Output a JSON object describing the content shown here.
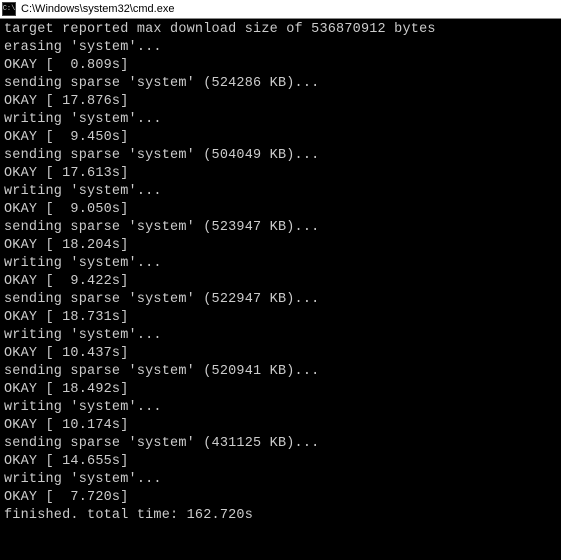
{
  "window": {
    "title": "C:\\Windows\\system32\\cmd.exe",
    "icon_label": "C:\\"
  },
  "lines": [
    "target reported max download size of 536870912 bytes",
    "erasing 'system'...",
    "OKAY [  0.809s]",
    "sending sparse 'system' (524286 KB)...",
    "OKAY [ 17.876s]",
    "writing 'system'...",
    "OKAY [  9.450s]",
    "sending sparse 'system' (504049 KB)...",
    "OKAY [ 17.613s]",
    "writing 'system'...",
    "OKAY [  9.050s]",
    "sending sparse 'system' (523947 KB)...",
    "OKAY [ 18.204s]",
    "writing 'system'...",
    "OKAY [  9.422s]",
    "sending sparse 'system' (522947 KB)...",
    "OKAY [ 18.731s]",
    "writing 'system'...",
    "OKAY [ 10.437s]",
    "sending sparse 'system' (520941 KB)...",
    "OKAY [ 18.492s]",
    "writing 'system'...",
    "OKAY [ 10.174s]",
    "sending sparse 'system' (431125 KB)...",
    "OKAY [ 14.655s]",
    "writing 'system'...",
    "OKAY [  7.720s]",
    "finished. total time: 162.720s"
  ]
}
